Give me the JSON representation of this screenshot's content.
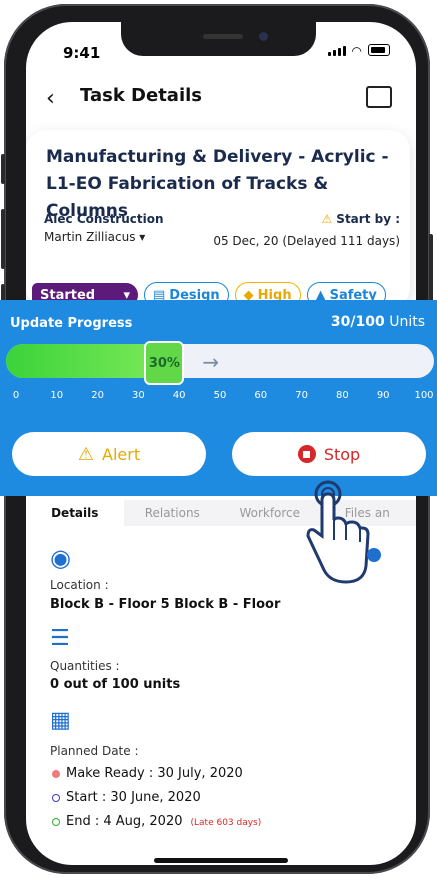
{
  "status_bar": {
    "time": "9:41"
  },
  "header": {
    "title": "Task Details"
  },
  "task": {
    "title": "Manufacturing & Delivery - Acrylic - L1-EO Fabrication of Tracks & Columns",
    "company": "Alec Construction",
    "assignee": "Martin Zilliacus",
    "start_by_label": "Start by :",
    "start_date": "05 Dec, 20 (Delayed 111 days)"
  },
  "badges": {
    "status": "Started",
    "design": "Design",
    "priority": "High",
    "safety": "Safety"
  },
  "progress": {
    "title": "Update Progress",
    "units_done": "30/100",
    "units_label": "Units",
    "percent_label": "30%",
    "fraction": 0.3,
    "ticks": [
      "0",
      "10",
      "20",
      "30",
      "40",
      "50",
      "60",
      "70",
      "80",
      "90",
      "100"
    ]
  },
  "actions": {
    "alert": "Alert",
    "stop": "Stop"
  },
  "tabs": [
    {
      "label": "Details"
    },
    {
      "label": "Relations"
    },
    {
      "label": "Workforce"
    },
    {
      "label": "Files an"
    }
  ],
  "details": {
    "location_label": "Location :",
    "location_value": "Block B - Floor 5 Block B - Floor",
    "quantities_label": "Quantities :",
    "quantities_value": "0 out of 100 units",
    "planned_label": "Planned Date :",
    "make_ready": "Make Ready : 30 July, 2020",
    "start": "Start : 30 June, 2020",
    "end": "End : 4 Aug, 2020",
    "late": "(Late 603 days)"
  },
  "colors": {
    "accent": "#1e8ae0",
    "started": "#5c1a7a",
    "alert": "#e8a800",
    "stop": "#d62828",
    "progress": "#3bd33a"
  }
}
